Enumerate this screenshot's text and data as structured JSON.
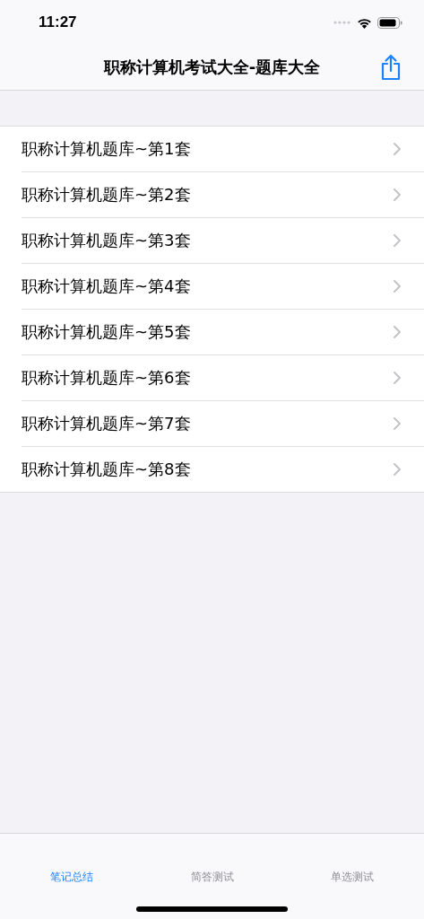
{
  "status_bar": {
    "time": "11:27"
  },
  "nav": {
    "title": "职称计算机考试大全-题库大全"
  },
  "list": [
    {
      "label": "职称计算机题库~第1套"
    },
    {
      "label": "职称计算机题库~第2套"
    },
    {
      "label": "职称计算机题库~第3套"
    },
    {
      "label": "职称计算机题库~第4套"
    },
    {
      "label": "职称计算机题库~第5套"
    },
    {
      "label": "职称计算机题库~第6套"
    },
    {
      "label": "职称计算机题库~第7套"
    },
    {
      "label": "职称计算机题库~第8套"
    }
  ],
  "tabs": [
    {
      "label": "笔记总结",
      "selected": true
    },
    {
      "label": "简答测试",
      "selected": false
    },
    {
      "label": "单选测试",
      "selected": false
    }
  ]
}
